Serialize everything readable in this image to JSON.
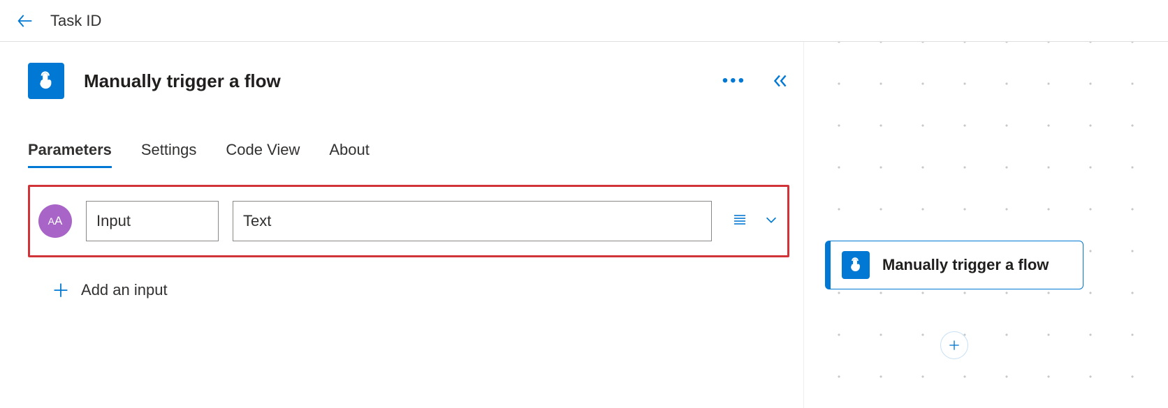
{
  "topbar": {
    "title": "Task ID"
  },
  "trigger": {
    "title": "Manually trigger a flow"
  },
  "tabs": [
    {
      "label": "Parameters",
      "active": true
    },
    {
      "label": "Settings",
      "active": false
    },
    {
      "label": "Code View",
      "active": false
    },
    {
      "label": "About",
      "active": false
    }
  ],
  "input_row": {
    "badge": "AA",
    "name": "Input",
    "value": "Text"
  },
  "add_input_label": "Add an input",
  "canvas_node": {
    "title": "Manually trigger a flow"
  }
}
